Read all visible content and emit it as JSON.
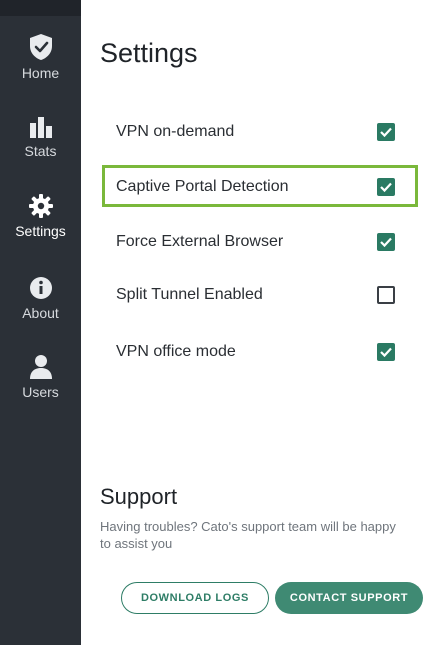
{
  "sidebar": {
    "items": [
      {
        "label": "Home",
        "icon": "shield-check-icon"
      },
      {
        "label": "Stats",
        "icon": "bar-chart-icon"
      },
      {
        "label": "Settings",
        "icon": "gear-icon"
      },
      {
        "label": "About",
        "icon": "info-icon"
      },
      {
        "label": "Users",
        "icon": "user-icon"
      }
    ],
    "active": "Settings"
  },
  "main": {
    "title": "Settings",
    "settings": [
      {
        "label": "VPN on-demand",
        "checked": true
      },
      {
        "label": "Captive Portal Detection",
        "checked": true,
        "highlighted": true
      },
      {
        "label": "Force External Browser",
        "checked": true
      },
      {
        "label": "Split Tunnel Enabled",
        "checked": false
      },
      {
        "label": "VPN office mode",
        "checked": true
      }
    ]
  },
  "support": {
    "title": "Support",
    "text": "Having troubles? Cato's support team will be happy to assist you",
    "download_logs_label": "DOWNLOAD LOGS",
    "contact_support_label": "CONTACT SUPPORT"
  },
  "colors": {
    "sidebar_bg": "#2b3037",
    "accent": "#2a7a63",
    "highlight_border": "#7ab83b"
  }
}
